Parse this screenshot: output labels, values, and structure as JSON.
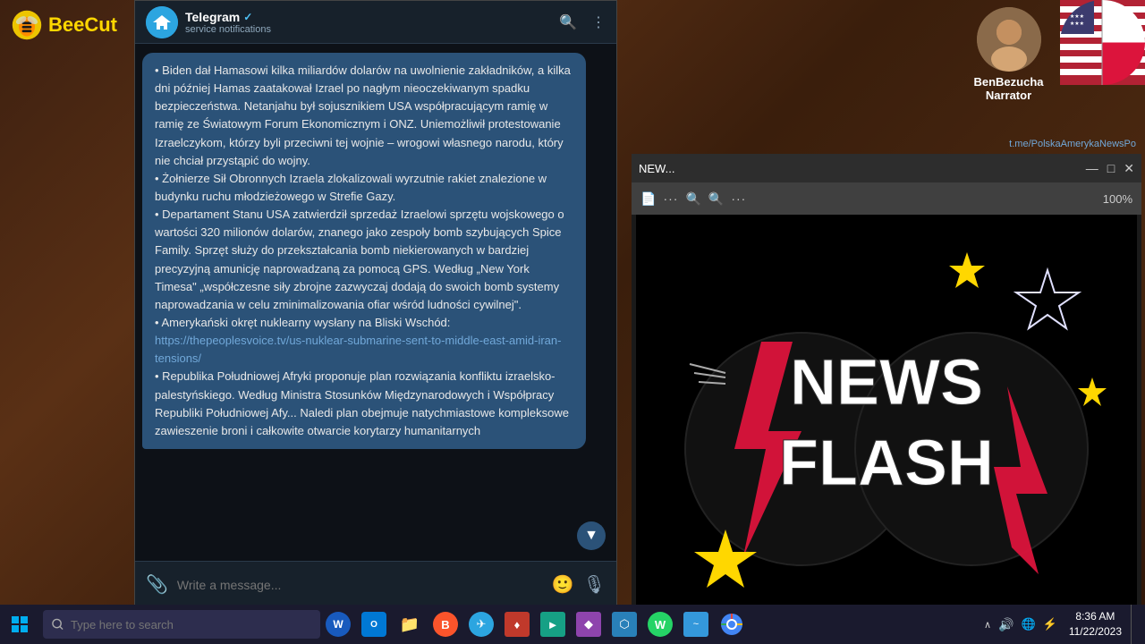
{
  "app": {
    "title": "BeeCut",
    "logo_text": "BeeCut"
  },
  "telegram": {
    "window_title": "Telegram",
    "verified_badge": "✓",
    "channel_name": "Telegram",
    "subtitle": "service notifications",
    "search_icon": "search",
    "more_icon": "⋮",
    "minimize": "—",
    "maximize": "□",
    "close": "✕",
    "message_content": "• Biden dał Hamasowi kilka miliardów dolarów na uwolnienie zakładników, a kilka dni później Hamas zaatakował Izrael po nagłym nieoczekiwanym spadku bezpieczeństwa. Netanjahu był sojusznikiem USA współpracującym ramię w ramię ze Światowym Forum Ekonomicznym i ONZ. Uniemożliwił protestowanie Izraelczykom, którzy byli przeciwni tej wojnie – wrogowi własnego narodu, który nie chciał przystąpić do wojny.\n• Żołnierze Sił Obronnych Izraela zlokalizowali wyrzutnie rakiet znalezione w budynku ruchu młodzieżowego w Strefie Gazy.\n• Departament Stanu USA zatwierdził sprzedaż Izraelowi sprzętu wojskowego o wartości 320 milionów dolarów, znanego jako zespoły bomb szybujących Spice Family. Sprzęt służy do przekształcania bomb niekierowanych w bardziej precyzyjną amunicję naprowadzaną za pomocą GPS. Według „New York Timesa\" „współczesne siły zbrojne zazwyczaj dodają do swoich bomb systemy naprowadzania w celu zminimalizowania ofiar wśród ludności cywilnej\".\n• Amerykański okręt nuklearny wysłany na Bliski Wschód:",
    "link_text": "https://thepeoplesvoice.tv/us-nuklear-submarine-sent-to-middle-east-amid-iran-tensions/",
    "message_content2": "• Republika Południowej Afryki proponuje plan rozwiązania konfliktu izraelsko-palestyńskiego. Według Ministra Stosunków Międzynarodowych i Współpracy Republiki Południowej Afy... Naledi plan obejmuje natychmiastowe kompleksowe zawieszenie broni i całkowite otwarcie korytarzy humanitarnych",
    "input_placeholder": "Write a message...",
    "attach_icon": "📎",
    "emoji_icon": "🙂",
    "mic_icon": "🎙"
  },
  "pdf_viewer": {
    "title": "NEW...",
    "zoom": "100%",
    "minimize": "—",
    "maximize": "□",
    "close": "✕"
  },
  "narrator": {
    "name": "BenBezucha",
    "role": "Narrator",
    "channel": "t.me/PolskaAmerykaNewsPo"
  },
  "taskbar": {
    "search_placeholder": "Type here to search",
    "time": "8:36 AM",
    "date": "11/22/2023",
    "start_icon": "⊞"
  },
  "taskbar_apps": [
    {
      "name": "Word",
      "color": "#185ABD",
      "letter": "W"
    },
    {
      "name": "Outlook",
      "color": "#0078D4",
      "letter": "O"
    },
    {
      "name": "Explorer",
      "color": "#FFC107",
      "letter": "📁"
    },
    {
      "name": "Brave",
      "color": "#fb542b",
      "letter": "B"
    },
    {
      "name": "Telegram",
      "color": "#2CA5E0",
      "letter": "✈"
    },
    {
      "name": "App6",
      "color": "#c0392b",
      "letter": "♦"
    },
    {
      "name": "App7",
      "color": "#16a085",
      "letter": "►"
    },
    {
      "name": "App8",
      "color": "#8e44ad",
      "letter": "◆"
    },
    {
      "name": "App9",
      "color": "#2980b9",
      "letter": "⬡"
    },
    {
      "name": "WhatsApp",
      "color": "#25D366",
      "letter": "W"
    },
    {
      "name": "App11",
      "color": "#3498db",
      "letter": "~"
    },
    {
      "name": "Chrome",
      "color": "#4285F4",
      "letter": "○"
    }
  ]
}
